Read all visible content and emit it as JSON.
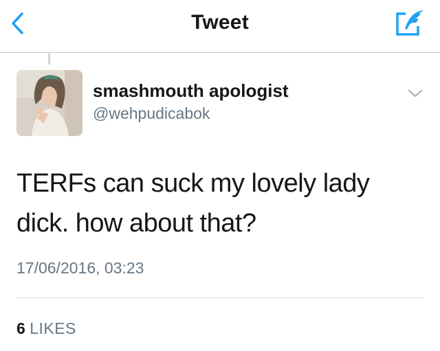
{
  "nav": {
    "title": "Tweet",
    "back_icon": "chevron-left-icon",
    "compose_icon": "compose-tweet-icon"
  },
  "tweet": {
    "author_name": "smashmouth apologist",
    "author_handle": "@wehpudicabok",
    "text": "TERFs can suck my lovely lady dick. how about that?",
    "timestamp": "17/06/2016, 03:23",
    "likes_count": "6",
    "likes_label": "LIKES"
  },
  "colors": {
    "accent": "#1da1f2",
    "primary_text": "#14171a",
    "secondary_text": "#657786",
    "divider": "#d8dde1"
  }
}
